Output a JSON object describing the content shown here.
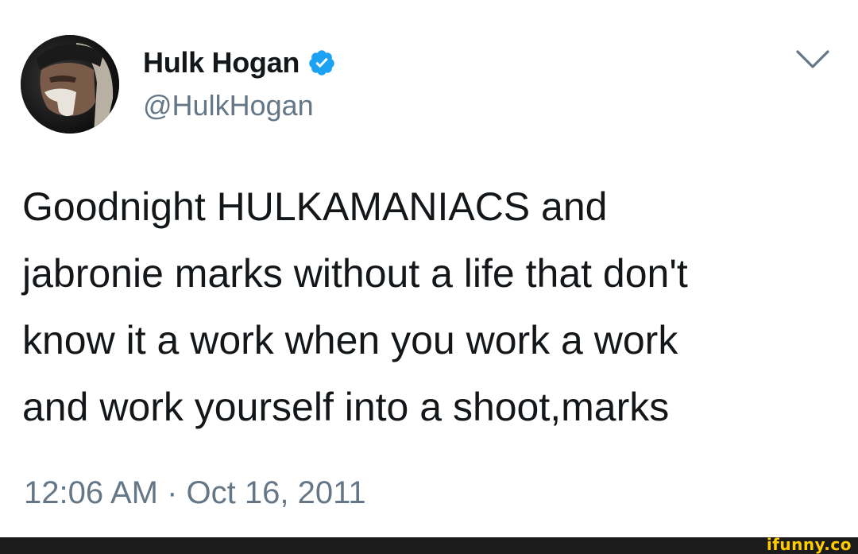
{
  "tweet": {
    "display_name": "Hulk Hogan",
    "handle": "@HulkHogan",
    "verified": true,
    "text": "Goodnight HULKAMANIACS and\njabronie marks without a life that don't\nknow it a work when you work a work\nand work yourself into a shoot,marks",
    "timestamp": "12:06 AM · Oct 16, 2011"
  },
  "footer": {
    "watermark": "ifunny.co"
  },
  "colors": {
    "verified_blue": "#1da1f2",
    "secondary_text": "#657786",
    "primary_text": "#14171a",
    "watermark_yellow": "#ffcc00"
  }
}
